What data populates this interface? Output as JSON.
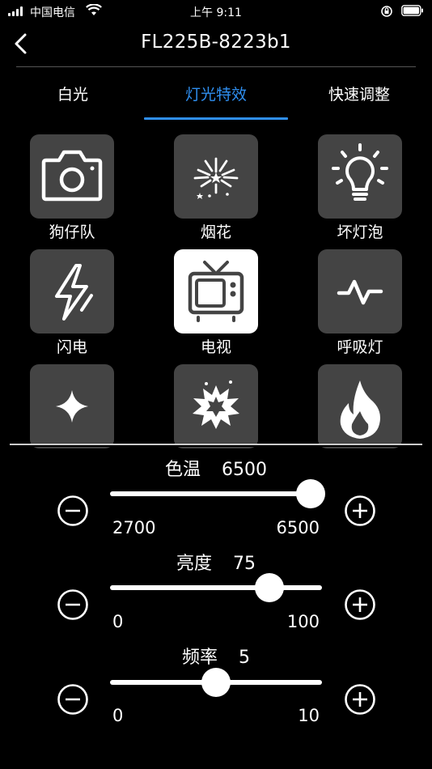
{
  "status_bar": {
    "carrier": "中国电信",
    "time": "上午 9:11"
  },
  "nav": {
    "title": "FL225B-8223b1"
  },
  "tabs": [
    {
      "label": "白光",
      "active": false
    },
    {
      "label": "灯光特效",
      "active": true
    },
    {
      "label": "快速调整",
      "active": false
    }
  ],
  "effects": [
    {
      "label": "狗仔队",
      "icon": "camera-icon",
      "active": false
    },
    {
      "label": "烟花",
      "icon": "fireworks-icon",
      "active": false
    },
    {
      "label": "坏灯泡",
      "icon": "lightbulb-icon",
      "active": false
    },
    {
      "label": "闪电",
      "icon": "lightning-icon",
      "active": false
    },
    {
      "label": "电视",
      "icon": "tv-icon",
      "active": true
    },
    {
      "label": "呼吸灯",
      "icon": "pulse-icon",
      "active": false
    },
    {
      "label": "",
      "icon": "sparkle-icon",
      "active": false
    },
    {
      "label": "",
      "icon": "explosion-icon",
      "active": false
    },
    {
      "label": "",
      "icon": "fire-icon",
      "active": false
    }
  ],
  "sliders": {
    "color_temp": {
      "label": "色温",
      "value": "6500",
      "min": "2700",
      "max": "6500",
      "fraction": 1.0
    },
    "brightness": {
      "label": "亮度",
      "value": "75",
      "min": "0",
      "max": "100",
      "fraction": 0.75
    },
    "frequency": {
      "label": "频率",
      "value": "5",
      "min": "0",
      "max": "10",
      "fraction": 0.5
    }
  },
  "colors": {
    "accent": "#2f8ff0",
    "tile": "#444444",
    "tile_active": "#ffffff"
  }
}
